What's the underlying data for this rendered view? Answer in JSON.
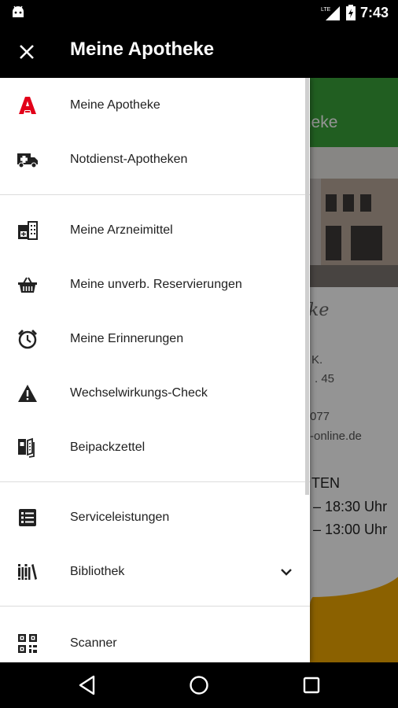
{
  "status_bar": {
    "time": "7:43",
    "network": "LTE",
    "icons": [
      "android-icon",
      "lte-signal-icon",
      "battery-charging-icon"
    ]
  },
  "toolbar": {
    "title": "Meine Apotheke",
    "close_icon": "close-icon"
  },
  "background_content": {
    "header_fragment": "theke",
    "logo_fragment": "ke",
    "line1": "K.",
    "line2": ". 45",
    "line3": "077",
    "line4": "-online.de",
    "heading": "TEN",
    "hours1": "– 18:30 Uhr",
    "hours2": "– 13:00 Uhr"
  },
  "drawer": {
    "sections": [
      {
        "items": [
          {
            "label": "Meine Apotheke",
            "icon": "apotheke-a-icon",
            "icon_color": "#e2001a"
          },
          {
            "label": "Notdienst-Apotheken",
            "icon": "ambulance-icon"
          }
        ]
      },
      {
        "items": [
          {
            "label": "Meine Arzneimittel",
            "icon": "medicine-pack-icon"
          },
          {
            "label": "Meine unverb. Reservierungen",
            "icon": "basket-icon"
          },
          {
            "label": "Meine Erinnerungen",
            "icon": "alarm-clock-icon"
          },
          {
            "label": "Wechselwirkungs-Check",
            "icon": "warning-icon"
          },
          {
            "label": "Beipackzettel",
            "icon": "leaflet-icon"
          }
        ]
      },
      {
        "items": [
          {
            "label": "Serviceleistungen",
            "icon": "list-icon"
          },
          {
            "label": "Bibliothek",
            "icon": "library-icon",
            "expand_icon": "chevron-down-icon"
          }
        ]
      },
      {
        "items": [
          {
            "label": "Scanner",
            "icon": "qr-code-icon"
          }
        ]
      }
    ]
  },
  "nav_bar": {
    "buttons": [
      "back-icon",
      "home-icon",
      "recents-icon"
    ]
  },
  "colors": {
    "toolbar": "#000000",
    "accent_red": "#e2001a",
    "header_green": "#3aa33a",
    "brand_yellow": "#f0a800"
  }
}
